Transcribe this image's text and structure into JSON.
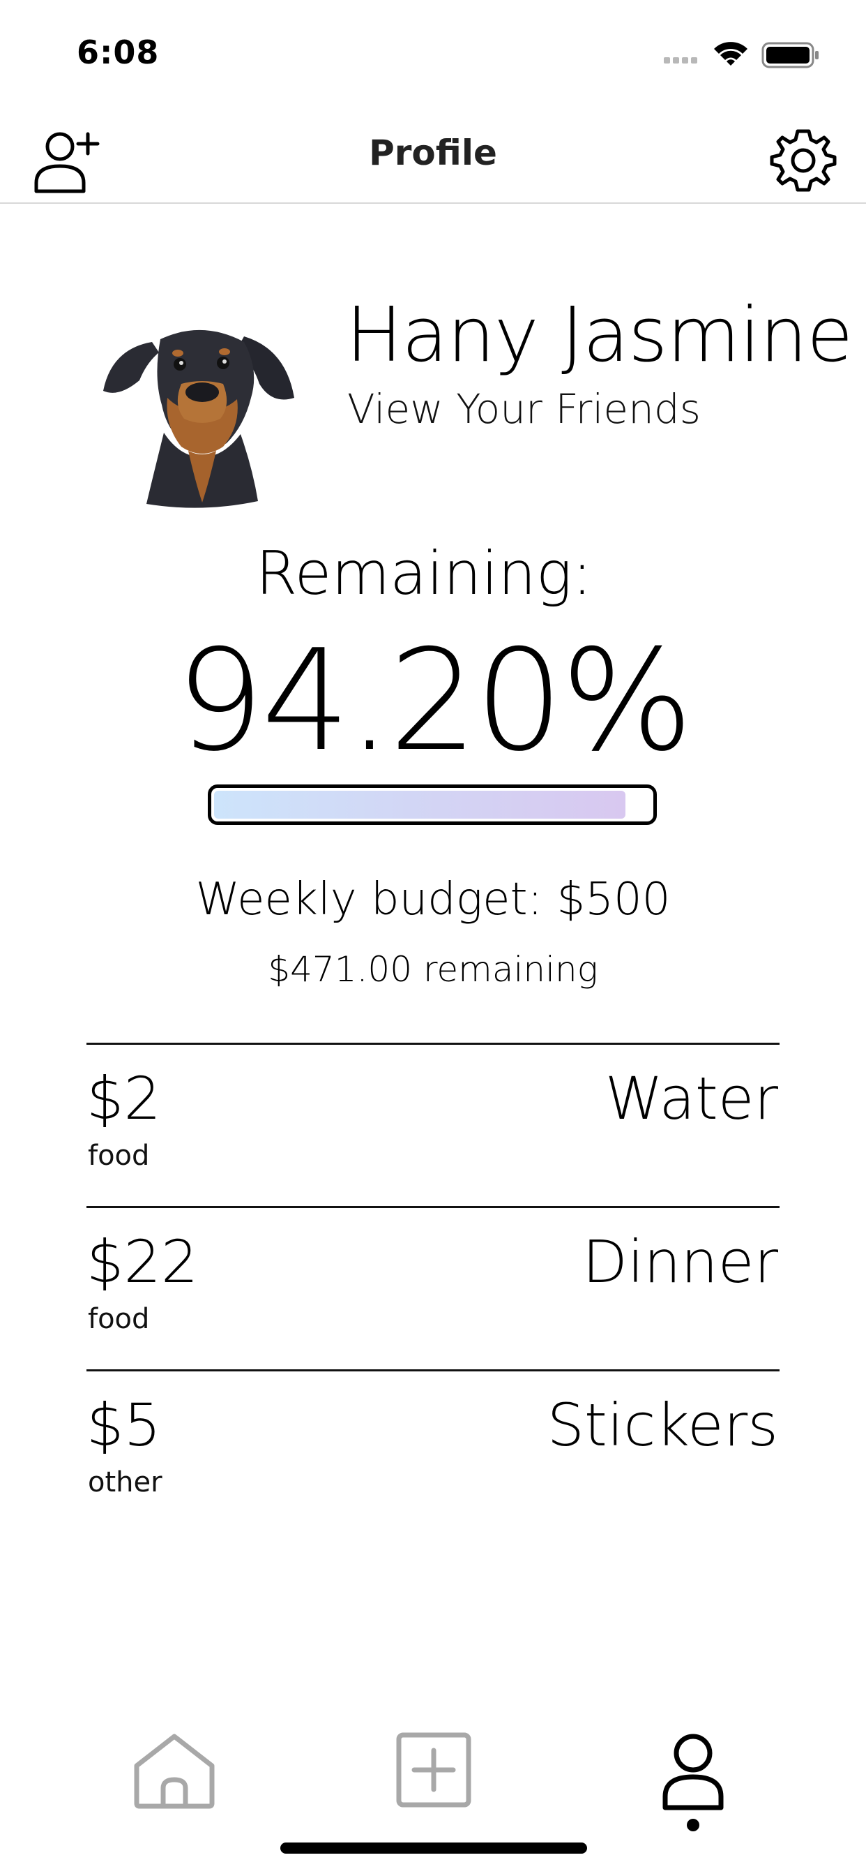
{
  "status_bar": {
    "time": "6:08"
  },
  "nav": {
    "title": "Profile"
  },
  "profile": {
    "name": "Hany Jasmine",
    "view_friends": "View Your Friends"
  },
  "budget": {
    "remaining_label": "Remaining:",
    "remaining_percent_text": "94.20%",
    "remaining_fraction": 0.942,
    "weekly_budget_text": "Weekly budget: $500",
    "remaining_amount_text": "$471.00 remaining"
  },
  "transactions": [
    {
      "amount": "$2",
      "category": "food",
      "name": "Water"
    },
    {
      "amount": "$22",
      "category": "food",
      "name": "Dinner"
    },
    {
      "amount": "$5",
      "category": "other",
      "name": "Stickers"
    }
  ],
  "tab_bar": {
    "tabs": [
      {
        "icon": "home-icon",
        "active": false
      },
      {
        "icon": "add-square-icon",
        "active": false
      },
      {
        "icon": "profile-icon",
        "active": true
      }
    ]
  },
  "colors": {
    "progress_start": "#cde4fb",
    "progress_end": "#d8c8f0",
    "inactive_icon": "#a8a8a8",
    "active_icon": "#000000"
  }
}
